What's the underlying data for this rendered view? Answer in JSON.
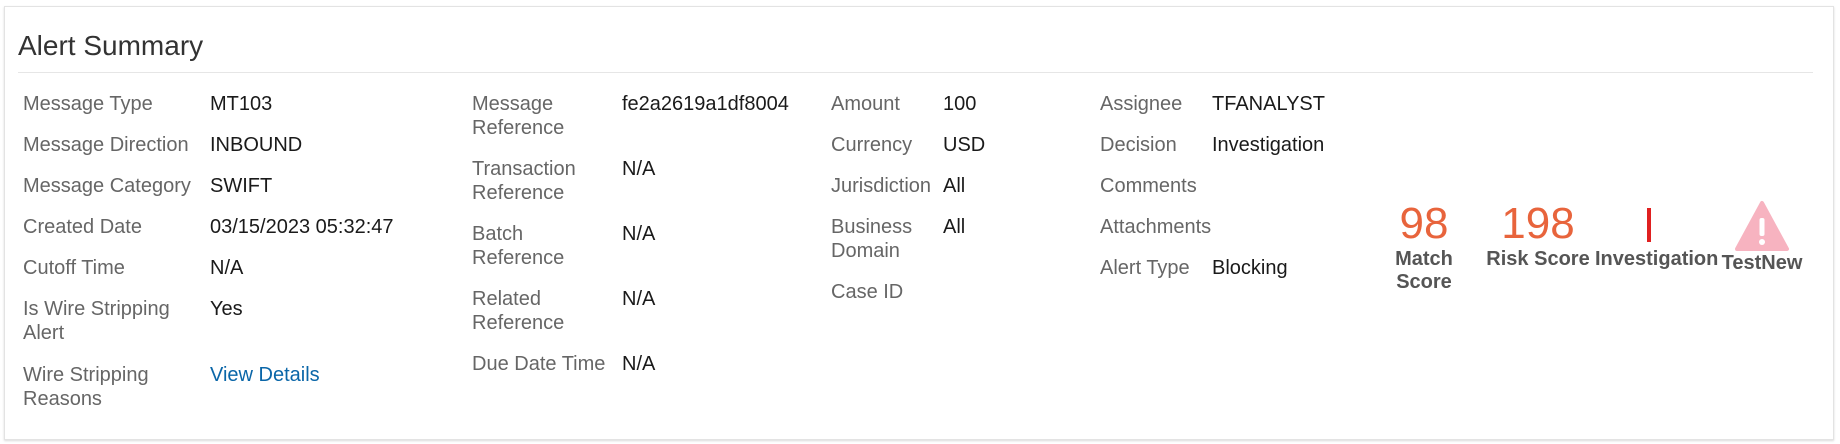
{
  "summary": {
    "title": "Alert Summary",
    "col1": [
      {
        "label": "Message Type",
        "value": "MT103"
      },
      {
        "label": "Message Direction",
        "value": "INBOUND"
      },
      {
        "label": "Message Category",
        "value": "SWIFT"
      },
      {
        "label": "Created Date",
        "value": "03/15/2023 05:32:47"
      },
      {
        "label": "Cutoff Time",
        "value": "N/A"
      },
      {
        "label": "Is Wire Stripping Alert",
        "value": "Yes"
      },
      {
        "label": "Wire Stripping Reasons",
        "value": "View Details"
      }
    ],
    "col2": [
      {
        "label": "Message Reference",
        "value": "fe2a2619a1df8004"
      },
      {
        "label": "Transaction Reference",
        "value": "N/A"
      },
      {
        "label": "Batch Reference",
        "value": "N/A"
      },
      {
        "label": "Related Reference",
        "value": "N/A"
      },
      {
        "label": "Due Date Time",
        "value": "N/A"
      }
    ],
    "col3": [
      {
        "label": "Amount",
        "value": "100"
      },
      {
        "label": "Currency",
        "value": "USD"
      },
      {
        "label": "Jurisdiction",
        "value": "All"
      },
      {
        "label": "Business Domain",
        "value": "All"
      },
      {
        "label": "Case ID",
        "value": ""
      }
    ],
    "col4": [
      {
        "label": "Assignee",
        "value": "TFANALYST"
      },
      {
        "label": "Decision",
        "value": "Investigation"
      },
      {
        "label": "Comments",
        "value": ""
      },
      {
        "label": "Attachments",
        "value": ""
      },
      {
        "label": "Alert Type",
        "value": "Blocking"
      }
    ]
  },
  "scores": {
    "match": {
      "value": "98",
      "label": "Match Score",
      "color": "#e8643c"
    },
    "risk": {
      "value": "198",
      "label": "Risk Score",
      "color": "#e8643c"
    },
    "investigation": {
      "label": "Investigation",
      "icon": "red-bar-icon",
      "color": "#e02020"
    },
    "testnew": {
      "label": "TestNew",
      "icon": "warning-triangle-icon",
      "color": "#f7b3c0"
    }
  }
}
